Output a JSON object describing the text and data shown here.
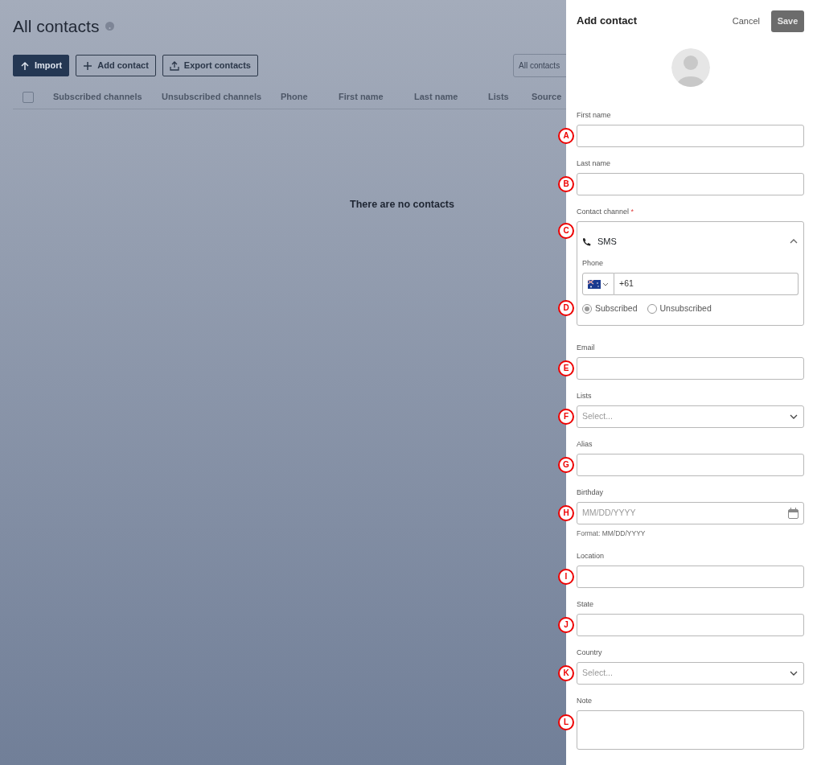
{
  "page": {
    "title": "All contacts",
    "buttons": [
      {
        "label": "Import",
        "kind": "primary"
      },
      {
        "label": "Add contact",
        "kind": "add"
      },
      {
        "label": "Export contacts",
        "kind": "export"
      }
    ],
    "filter": {
      "value": "All contacts"
    },
    "table": {
      "select_all": {
        "checked": false
      },
      "columns": [
        "Subscribed channels",
        "Unsubscribed channels",
        "Phone",
        "First name",
        "Last name",
        "Lists",
        "Source"
      ]
    },
    "empty_message": "There are no contacts"
  },
  "panel": {
    "title": "Add contact",
    "cancel": "Cancel",
    "save": {
      "label": "Save",
      "disabled": true
    },
    "fields": [
      {
        "kind": "text",
        "label": "First name",
        "callout": "A"
      },
      {
        "kind": "text",
        "label": "Last name",
        "callout": "B"
      },
      {
        "kind": "channel",
        "label": "Contact channel",
        "required": true,
        "required_mark": "*",
        "callout": "C",
        "channel": {
          "name": "SMS",
          "expanded": true,
          "phone_label": "Phone",
          "phone_value": "+61",
          "callout": "D",
          "options": [
            {
              "label": "Subscribed",
              "selected": true
            },
            {
              "label": "Unsubscribed",
              "selected": false
            }
          ]
        }
      },
      {
        "kind": "text",
        "label": "Email",
        "callout": "E"
      },
      {
        "kind": "select",
        "label": "Lists",
        "placeholder": "Select...",
        "callout": "F"
      },
      {
        "kind": "text",
        "label": "Alias",
        "callout": "G"
      },
      {
        "kind": "date",
        "label": "Birthday",
        "placeholder": "MM/DD/YYYY",
        "hint": "Format: MM/DD/YYYY",
        "callout": "H"
      },
      {
        "kind": "text",
        "label": "Location",
        "callout": "I"
      },
      {
        "kind": "text",
        "label": "State",
        "callout": "J"
      },
      {
        "kind": "select",
        "label": "Country",
        "placeholder": "Select...",
        "callout": "K"
      },
      {
        "kind": "textarea",
        "label": "Note",
        "callout": "L"
      }
    ]
  }
}
